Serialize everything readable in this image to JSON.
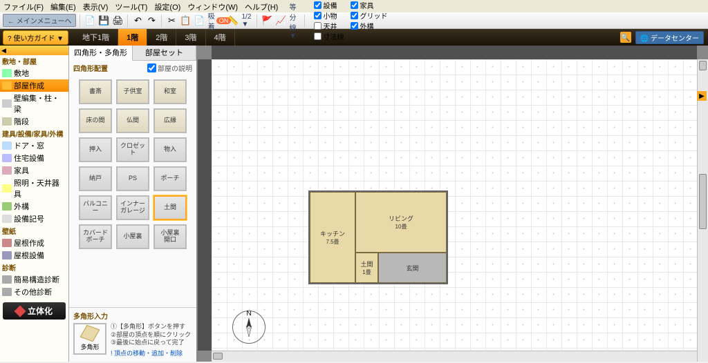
{
  "menubar": [
    "ファイル(F)",
    "編集(E)",
    "表示(V)",
    "ツール(T)",
    "設定(O)",
    "ウィンドウ(W)",
    "ヘルプ(H)"
  ],
  "toolbar1": {
    "back_label": "← メインメニューへ",
    "snap_label": "吸着",
    "snap_badge": "ON",
    "scale": "1/2 ▼",
    "linetype": "等分線 ▼",
    "checks": [
      {
        "label": "設備",
        "checked": true
      },
      {
        "label": "家具",
        "checked": true
      },
      {
        "label": "小物",
        "checked": true
      },
      {
        "label": "グリッド",
        "checked": true
      },
      {
        "label": "天井",
        "checked": false
      },
      {
        "label": "外構",
        "checked": true
      },
      {
        "label": "寸法線",
        "checked": false
      }
    ]
  },
  "toolbar2": {
    "guide": "? 使い方ガイド ▼",
    "floors": [
      "地下1階",
      "1階",
      "2階",
      "3階",
      "4階"
    ],
    "floor_active": 1,
    "datacenter": "🌐 データセンター"
  },
  "sidebar": {
    "scroll": "◀",
    "groups": [
      {
        "cat": "敷地・部屋",
        "items": [
          {
            "label": "敷地",
            "icon": "#8fa"
          },
          {
            "label": "部屋作成",
            "icon": "#fb3",
            "active": true
          },
          {
            "label": "壁編集・柱・梁",
            "icon": "#ccc"
          },
          {
            "label": "階段",
            "icon": "#cca"
          }
        ]
      },
      {
        "cat": "建具/設備/家具/外構",
        "items": [
          {
            "label": "ドア・窓",
            "icon": "#bdf"
          },
          {
            "label": "住宅設備",
            "icon": "#bbf"
          },
          {
            "label": "家具",
            "icon": "#dab"
          },
          {
            "label": "照明・天井器具",
            "icon": "#ff8"
          },
          {
            "label": "外構",
            "icon": "#9c7"
          },
          {
            "label": "設備記号",
            "icon": "#ddd"
          }
        ]
      },
      {
        "cat": "壁紙",
        "items": [
          {
            "label": "屋根作成",
            "icon": "#c88"
          },
          {
            "label": "屋根設備",
            "icon": "#99b"
          }
        ]
      },
      {
        "cat": "診断",
        "items": [
          {
            "label": "簡易構造診断",
            "icon": "#aaa"
          },
          {
            "label": "その他診断",
            "icon": "#aaa"
          }
        ]
      }
    ],
    "threed": "立体化"
  },
  "palette": {
    "tabs": [
      "四角形・多角形",
      "部屋セット"
    ],
    "tab_active": 0,
    "section_title": "四角形配置",
    "desc_check": "部屋の説明",
    "rooms": [
      {
        "label": "書斎"
      },
      {
        "label": "子供室"
      },
      {
        "label": "和室"
      },
      {
        "label": "床の間"
      },
      {
        "label": "仏間"
      },
      {
        "label": "広縁"
      },
      {
        "label": "押入",
        "stone": true
      },
      {
        "label": "クロゼット",
        "stone": true
      },
      {
        "label": "物入",
        "stone": true
      },
      {
        "label": "納戸",
        "stone": true
      },
      {
        "label": "PS",
        "stone": true
      },
      {
        "label": "ポーチ",
        "stone": true
      },
      {
        "label": "バルコニー",
        "stone": true
      },
      {
        "label": "インナー\nガレージ",
        "stone": true
      },
      {
        "label": "土間",
        "stone": true,
        "selected": true
      },
      {
        "label": "カバード\nポーチ",
        "stone": true
      },
      {
        "label": "小屋裏",
        "stone": true
      },
      {
        "label": "小屋裏\n開口",
        "stone": true
      }
    ],
    "poly_title": "多角形入力",
    "poly_label": "多角形",
    "poly_help": "①【多角形】ボタンを押す\n②部屋の頂点を順にクリック\n③最後に始点に戻って完了",
    "poly_hint": "! 頂点の移動・追加・削除"
  },
  "chart_data": {
    "type": "floorplan",
    "rooms": [
      {
        "name": "キッチン",
        "size": "7.5畳"
      },
      {
        "name": "リビング",
        "size": "10畳"
      },
      {
        "name": "土間",
        "size": "1畳"
      },
      {
        "name": "玄関",
        "size": ""
      }
    ],
    "compass": "N"
  }
}
